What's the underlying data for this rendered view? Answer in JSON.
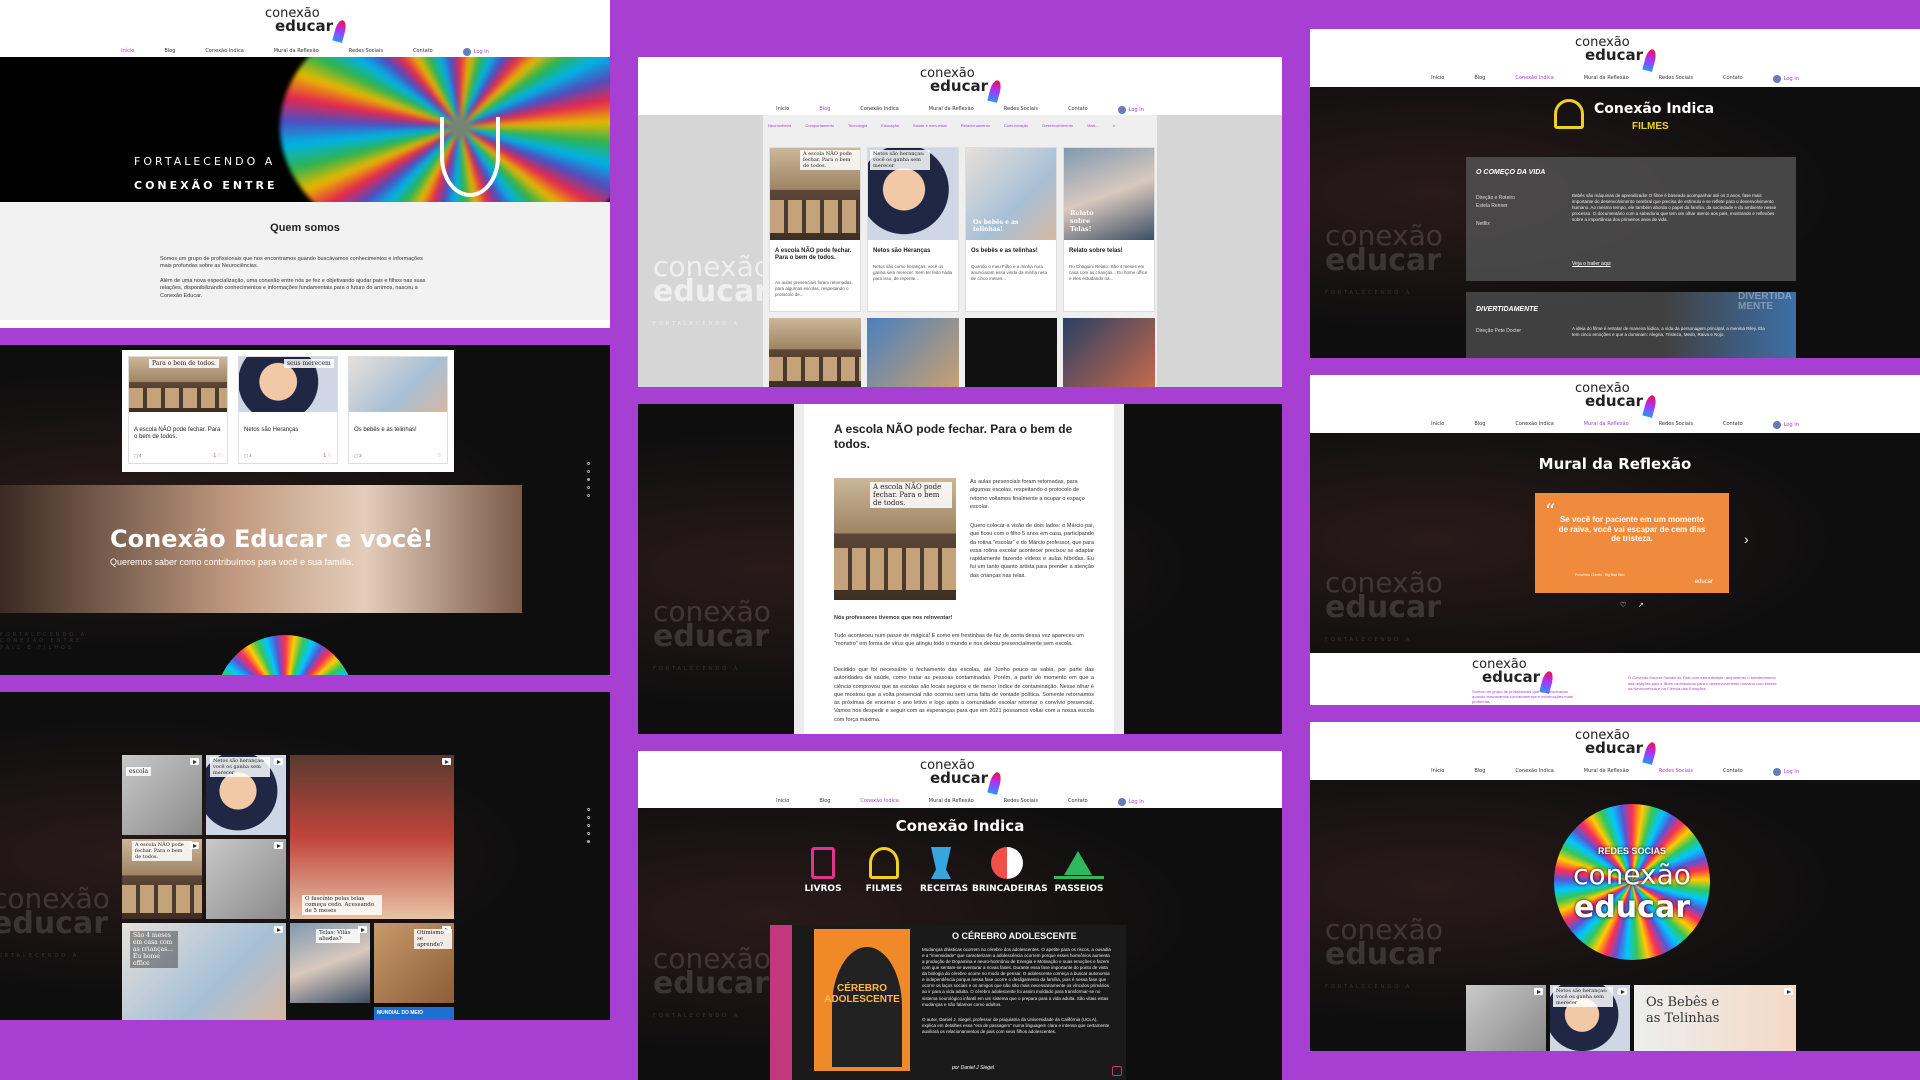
{
  "brand": {
    "line1": "conexão",
    "line2": "educar",
    "wm_line1": "conexão",
    "wm_line2": "educar",
    "wm_tag1": "FORTALECENDO  A",
    "wm_tag2": "CONEXÃO  ENTRE",
    "wm_tag3": "PAIS  E  FILHOS"
  },
  "nav": [
    "Início",
    "Blog",
    "Conexão Indica",
    "Mural da Reflexão",
    "Redes Sociais",
    "Contato"
  ],
  "login_label": "Log In",
  "p1": {
    "hero_line1": "FORTALECENDO  A",
    "hero_line2": "CONEXÃO  ENTRE",
    "about_title": "Quem somos",
    "about_p1": "Somos um grupo de profissionais que nos encontramos quando buscávamos conhecimentos e informações mais profundas sobre as Neurociências.",
    "about_p2": "Além de uma nova especialização, uma conexão entre nós se fez e objetivando ajudar pais e filhos nas suas relações, disponibilizando conhecimentos e informações fundamentais para o futuro do arrimos, nasceu a Conexão Educar."
  },
  "p2": {
    "cards": [
      {
        "overlay": "Para o bem de todos.",
        "title": "A escola NÃO pode fechar. Para o bem de todos.",
        "views": "4",
        "likes": "1"
      },
      {
        "overlay": "seus merecem",
        "title": "Netos são Heranças",
        "views": "4",
        "likes": "1"
      },
      {
        "overlay": "",
        "title": "Os bebês e as telinhas!",
        "views": "3",
        "likes": ""
      }
    ],
    "banner_title": "Conexão Educar e você!",
    "banner_sub": "Queremos saber como contribuímos para você e sua família."
  },
  "p3": {
    "thumbs": [
      "escola",
      "Netos são heranças: você os ganha sem merecer",
      "",
      "A escola NÃO pode fechar. Para o bem de todos.",
      "",
      "O fascínio pelas telas começa cedo. Acessando de 5 meses",
      "",
      "São 4 meses em casa com as crianças... Eu home office",
      "Telas: Vilãs aliadas?",
      "Otimismo se aprende?",
      "MUNDIAL DO MEIO"
    ]
  },
  "blog": {
    "categories": [
      "Neurociência",
      "Comportamento",
      "Tecnologia",
      "Educação",
      "Saúde e bem-estar",
      "Relacionamento",
      "Comunicação",
      "Desenvolvimento",
      "Mais..."
    ],
    "cards": [
      {
        "overlay": "A escola NÃO pode fechar. Para o bem de todos.",
        "title": "A escola NÃO pode fechar. Para o bem de todos.",
        "desc": "As aulas presenciais foram retomadas, para algumas escolas, respeitando o protocolo de..."
      },
      {
        "overlay": "Netos são heranças: você os ganha sem merecer",
        "title": "Netos são Heranças",
        "desc": "Netos são como heranças: você os ganha sem merecer. Sem ter feito nada para isso, de repente..."
      },
      {
        "overlay": "Os bebês e as telinhas!",
        "title": "Os bebês e as telinhas!",
        "desc": "Quando o meu Filho e a minha nora anunciaram essa vinda da minha neta de cinco meses..."
      },
      {
        "overlay": "Relato sobre Telas!",
        "title": "Relato sobre telas!",
        "desc": "Ro Chaguini Relato: São 4 meses em casa com as crianças... Eu home office e eles estudando na..."
      }
    ]
  },
  "article": {
    "title": "A escola NÃO pode fechar. Para o bem de todos.",
    "img_caption": "A escola NÃO pode fechar. Para o bem de todos.",
    "p1": "As aulas presenciais foram retomadas, para algumas escolas, respeitando o protocolo de retorno voltamos finalmente a ocupar o espaço escolar.",
    "p2": "Quero colocar a visão de dois lados: o Márcio pai, que ficou com o filho 5 anos em casa, participando da rotina \"escolar\" e do Márcio professor, que para essa rotina escolar acontecer precisou se adaptar rapidamente fazendo vídeos e aulas híbridas. Eu fui um tanto quanto artista para prender a atenção das crianças nas telas.",
    "p3": "Nós professores tivemos que nos reinventar!",
    "p4": "Tudo aconteceu num passe de mágica! E como em frestinhas de faz de conta dessa vez apareceu um \"monstro\" em forma de vírus que atingiu todo o mundo e nos deixou presencialmente sem escola.",
    "p5": "Decidido que foi necessário o fechamento das escolas, até Junho pouco se sabia, por parte das autoridades da saúde, como tratar as pessoas contaminadas. Porém, a partir do momento em que a ciência comprovou que as escolas são locais seguros e de menor índice de contaminação. Nesse olhar é que mostrou que a volta presencial não ocorreu sem uma falta de vontade política. Somente retornamos às próximas de encerrar o ano letivo e logo após a comunidade escolar retornar o convívio presencial. Vamos nos despedir e seguir com as esperanças para que em 2021 possamos voltar com a nossa escola com força máxima."
  },
  "indica": {
    "title": "Conexão Indica",
    "cats": [
      "LIVROS",
      "FILMES",
      "RECEITAS",
      "BRINCADEIRAS",
      "PASSEIOS"
    ],
    "book_title": "O CÉREBRO ADOLESCENTE",
    "book_cover": "CÉREBRO ADOLESCENTE",
    "book_text": "Mudanças drásticas ocorrem no cérebro dos adolescentes. O apetite para os riscos, a ousadia e a \"imensidade\" que caracterizam a adolescência ocorrem porque esses hormônios aumenta a produção de Dopamina e neuro-hormônio de Energia e Motivação e suas emoções e fazem com que sentam-se aventurar a novas fases. Durante essa fase importante do ponto de vista da biologia do cérebro ocorre no modo de pensar. O adolescente começa a buscar autonomia e independência porque nessa fase ocorre o desligamento da família, pois é nessa fase que ocorre os laços sociais e os amigos que não são mais necessariamente os vínculos primários ao ir para a vida adulta. O cérebro adolescente foi assim moldado para transformar-se no sistema neurológico infantil em um sistema que o prepara para a vida adulta. São vitais estas mudanças e não falamos como adultos.",
    "book_text2": "O autor, Daniel J. Siegel, professor de psiquiatria da Universidade da Califórnia (UCLA), explica em detalhes essa \"era de passagem\" numa linguagem clara e intensa que certamente auxiliará os relacionamentos de pais com seus filhos adolescentes.",
    "book_author": "por Daniel J Siegel"
  },
  "filmes": {
    "title": "Conexão Indica",
    "sub": "FILMES",
    "f1_title": "O COMEÇO DA VIDA",
    "f1_meta1": "Direção e Roteiro",
    "f1_meta2": "Estela Renner",
    "f1_meta3": "Netflix",
    "f1_text": "Bebês são máquinas de aprendizado! O filme é baseado acompanhar até os 3 anos, fase mais importante do desenvolvimento cerebral que precisa de estímulo e se reflete para o desenvolvimento humano. Ao mesmo tempo, ele também aborda o papel da família, da sociedade e do ambiente nesse processo. O documentário com a sabedoria que tem um olhar atento aos pais, mostrando e reflexões sobre a importância dos primeiros anos de vida.",
    "f1_link": "Veja o trailer aqui",
    "f2_title": "DIVERTIDAMENTE",
    "f2_meta": "Direção Pete Docter",
    "f2_text": "A ideia do filme é retratar de maneira lúdica, a vida da personagem principal, a menina Riley. Ela tem cinco emoções e que a dominam: Alegria, Tristeza, Medo, Raiva e Nojo.",
    "poster_word": "DIVERTIDA MENTE"
  },
  "mural": {
    "title": "Mural da Reflexão",
    "quote": "Se você for paciente em um momento de raiva, você vai escapar de cem dias de tristeza.",
    "quote_src": "Provérbio Chinês - Big Bad Bird",
    "footer_text1": "Somos um grupo de profissionais que se encontraram quando buscávamos conhecimentos e informações mais profundas",
    "footer_text2": "O Conexão Educar Sociais de Pais com estes desiste: amparamer o fortalecimento das relações pais e filhos contribuindo para o desenvolvimento humano com ênfase na Neurociência e na Ciência das Emoções"
  },
  "redes": {
    "circle_l1": "REDES SOCIAS",
    "circle_l2": "conexão",
    "circle_l3": "educar",
    "thumbs": [
      "",
      "Netos são heranças: você os ganha sem merecer",
      "Os Bebês e as Telinhas"
    ]
  },
  "colors": {
    "accent": "#a63fd2",
    "orange": "#f08a3c",
    "panel_dark": "#0e0e0e"
  }
}
